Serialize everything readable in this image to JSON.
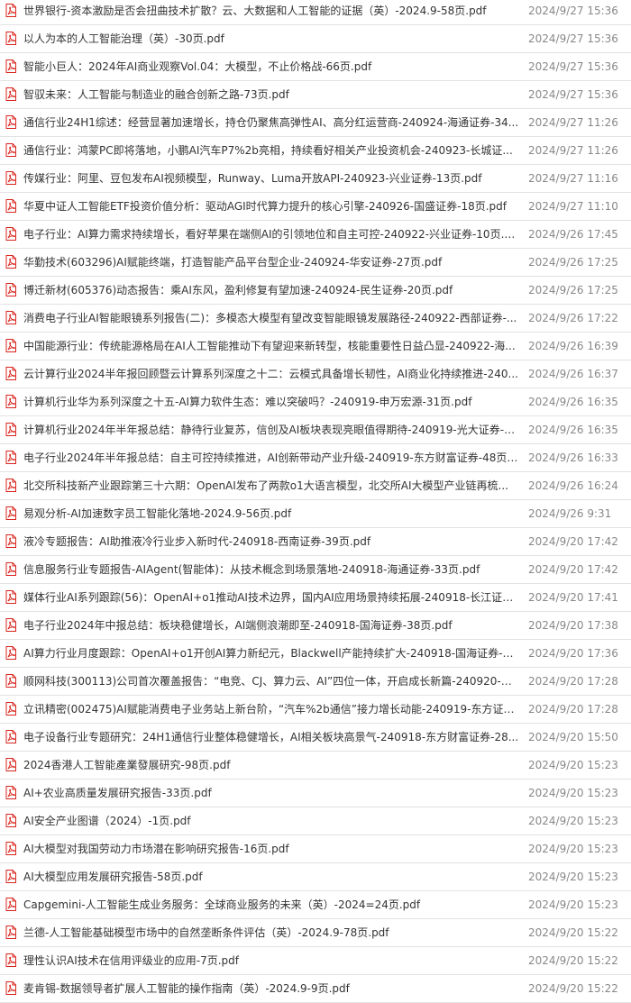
{
  "files": [
    {
      "name": "世界银行-资本激励是否会扭曲技术扩散？云、大数据和人工智能的证据（英）-2024.9-58页.pdf",
      "date": "2024/9/27 15:36",
      "icon": "pdf-icon"
    },
    {
      "name": "以人为本的人工智能治理（英）-30页.pdf",
      "date": "2024/9/27 15:36",
      "icon": "pdf-icon"
    },
    {
      "name": "智能小巨人：2024年AI商业观察Vol.04：大模型，不止价格战-66页.pdf",
      "date": "2024/9/27 15:36",
      "icon": "pdf-icon"
    },
    {
      "name": "智驭未来：人工智能与制造业的融合创新之路-73页.pdf",
      "date": "2024/9/27 15:36",
      "icon": "pdf-icon"
    },
    {
      "name": "通信行业24H1综述：经营显著加速增长，持仓仍聚焦高弹性AI、高分红运营商-240924-海通证券-34...",
      "date": "2024/9/27 11:26",
      "icon": "pdf-icon"
    },
    {
      "name": "通信行业：鸿蒙PC即将落地，小鹏AI汽车P7%2b亮相，持续看好相关产业投资机会-240923-长城证...",
      "date": "2024/9/27 11:26",
      "icon": "pdf-icon"
    },
    {
      "name": "传媒行业：阿里、豆包发布AI视频模型，Runway、Luma开放API-240923-兴业证券-13页.pdf",
      "date": "2024/9/27 11:16",
      "icon": "pdf-icon"
    },
    {
      "name": "华夏中证人工智能ETF投资价值分析：驱动AGI时代算力提升的核心引擎-240926-国盛证券-18页.pdf",
      "date": "2024/9/27 11:10",
      "icon": "pdf-icon"
    },
    {
      "name": "电子行业：AI算力需求持续增长，看好苹果在端侧AI的引领地位和自主可控-240922-兴业证券-10页.p...",
      "date": "2024/9/26 17:45",
      "icon": "pdf-icon"
    },
    {
      "name": "华勤技术(603296)AI赋能终端，打造智能产品平台型企业-240924-华安证券-27页.pdf",
      "date": "2024/9/26 17:25",
      "icon": "pdf-icon"
    },
    {
      "name": "博迁新材(605376)动态报告：乘AI东风，盈利修复有望加速-240924-民生证券-20页.pdf",
      "date": "2024/9/26 17:25",
      "icon": "pdf-icon"
    },
    {
      "name": "消费电子行业AI智能眼镜系列报告(二)：多模态大模型有望改变智能眼镜发展路径-240922-西部证券-...",
      "date": "2024/9/26 17:22",
      "icon": "pdf-icon"
    },
    {
      "name": "中国能源行业：传统能源格局在AI人工智能推动下有望迎来新转型，核能重要性日益凸显-240922-海...",
      "date": "2024/9/26 16:39",
      "icon": "pdf-icon"
    },
    {
      "name": "云计算行业2024半年报回顾暨云计算系列深度之十二：云模式具备增长韧性，AI商业化持续推进-240...",
      "date": "2024/9/26 16:37",
      "icon": "pdf-icon"
    },
    {
      "name": "计算机行业华为系列深度之十五-AI算力软件生态：难以突破吗？-240919-申万宏源-31页.pdf",
      "date": "2024/9/26 16:35",
      "icon": "pdf-icon"
    },
    {
      "name": "计算机行业2024年半年报总结：静待行业复苏，信创及AI板块表现亮眼值得期待-240919-光大证券-1...",
      "date": "2024/9/26 16:35",
      "icon": "pdf-icon"
    },
    {
      "name": "电子行业2024年半年报总结：自主可控持续推进，AI创新带动产业升级-240919-东方财富证券-48页....",
      "date": "2024/9/26 16:33",
      "icon": "pdf-icon"
    },
    {
      "name": "北交所科技新产业跟踪第三十六期：OpenAI发布了两款o1大语言模型，北交所AI大模型产业链再梳...",
      "date": "2024/9/26 16:24",
      "icon": "pdf-icon"
    },
    {
      "name": "易观分析-AI加速数字员工智能化落地-2024.9-56页.pdf",
      "date": "2024/9/26 9:31",
      "icon": "pdf-icon"
    },
    {
      "name": "液冷专题报告：AI助推液冷行业步入新时代-240918-西南证券-39页.pdf",
      "date": "2024/9/20 17:42",
      "icon": "pdf-icon"
    },
    {
      "name": "信息服务行业专题报告-AIAgent(智能体)：从技术概念到场景落地-240918-海通证券-33页.pdf",
      "date": "2024/9/20 17:42",
      "icon": "pdf-icon"
    },
    {
      "name": "媒体行业AI系列跟踪(56)：OpenAI+o1推动AI技术边界，国内AI应用场景持续拓展-240918-长江证券-...",
      "date": "2024/9/20 17:41",
      "icon": "pdf-icon"
    },
    {
      "name": "电子行业2024年中报总结：板块稳健增长，AI端侧浪潮即至-240918-国海证券-38页.pdf",
      "date": "2024/9/20 17:38",
      "icon": "pdf-icon"
    },
    {
      "name": "AI算力行业月度跟踪：OpenAI+o1开创AI算力新纪元，Blackwell产能持续扩大-240918-国海证券-2...",
      "date": "2024/9/20 17:36",
      "icon": "pdf-icon"
    },
    {
      "name": "顺网科技(300113)公司首次覆盖报告：“电竞、CJ、算力云、AI”四位一体，开启成长新篇-240920-开...",
      "date": "2024/9/20 17:28",
      "icon": "pdf-icon"
    },
    {
      "name": "立讯精密(002475)AI赋能消费电子业务站上新台阶，“汽车%2b通信”接力增长动能-240919-东方证券-...",
      "date": "2024/9/20 17:28",
      "icon": "pdf-icon"
    },
    {
      "name": "电子设备行业专题研究：24H1通信行业整体稳健增长，AI相关板块高景气-240918-东方财富证券-28...",
      "date": "2024/9/20 15:50",
      "icon": "pdf-icon"
    },
    {
      "name": "2024香港人工智能產業發展研究-98页.pdf",
      "date": "2024/9/20 15:23",
      "icon": "pdf-icon"
    },
    {
      "name": "AI+农业高质量发展研究报告-33页.pdf",
      "date": "2024/9/20 15:23",
      "icon": "pdf-icon"
    },
    {
      "name": "AI安全产业图谱（2024）-1页.pdf",
      "date": "2024/9/20 15:23",
      "icon": "pdf-icon"
    },
    {
      "name": "AI大模型对我国劳动力市场潜在影响研究报告-16页.pdf",
      "date": "2024/9/20 15:23",
      "icon": "pdf-icon"
    },
    {
      "name": "AI大模型应用发展研究报告-58页.pdf",
      "date": "2024/9/20 15:23",
      "icon": "pdf-icon"
    },
    {
      "name": "Capgemini-人工智能生成业务服务：全球商业服务的未来（英）-2024=24页.pdf",
      "date": "2024/9/20 15:23",
      "icon": "pdf-icon"
    },
    {
      "name": "兰德-人工智能基础模型市场中的自然垄断条件评估（英）-2024.9-78页.pdf",
      "date": "2024/9/20 15:22",
      "icon": "pdf-icon"
    },
    {
      "name": "理性认识AI技术在信用评级业的应用-7页.pdf",
      "date": "2024/9/20 15:22",
      "icon": "pdf-icon"
    },
    {
      "name": "麦肯锡-数据领导者扩展人工智能的操作指南（英）-2024.9-9页.pdf",
      "date": "2024/9/20 15:22",
      "icon": "pdf-icon"
    }
  ],
  "colors": {
    "pdf_red": "#d9241c",
    "text": "#333333",
    "date": "#888888",
    "divider": "#e2e2e2"
  }
}
